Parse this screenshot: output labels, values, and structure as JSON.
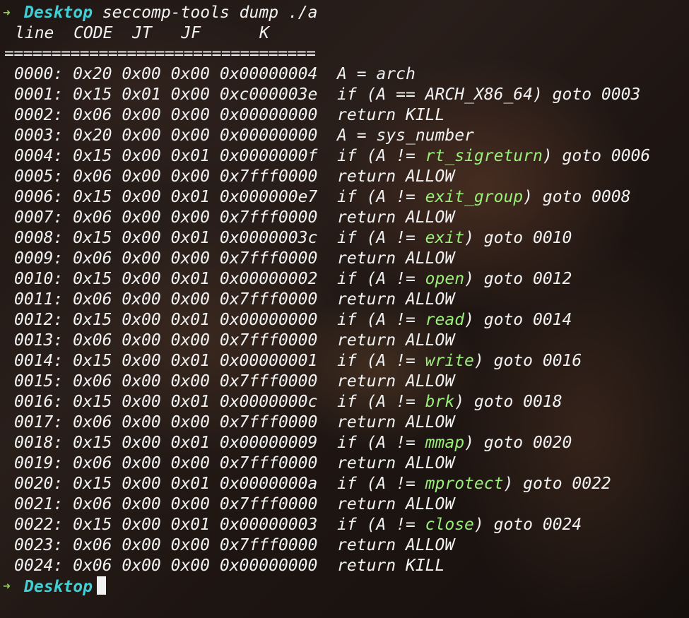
{
  "terminal": {
    "prompt_arrow": "➜",
    "directory": "Desktop",
    "command": "seccomp-tools dump ./a",
    "header": "line  CODE  JT   JF      K",
    "separator": "=================================",
    "rows": [
      {
        "addr": "0000:",
        "code": "0x20",
        "jt": "0x00",
        "jf": "0x00",
        "k": "0x00000004",
        "pre": "A = arch",
        "name": "",
        "post": ""
      },
      {
        "addr": "0001:",
        "code": "0x15",
        "jt": "0x01",
        "jf": "0x00",
        "k": "0xc000003e",
        "pre": "if (A == ARCH_X86_64) goto 0003",
        "name": "",
        "post": ""
      },
      {
        "addr": "0002:",
        "code": "0x06",
        "jt": "0x00",
        "jf": "0x00",
        "k": "0x00000000",
        "pre": "return KILL",
        "name": "",
        "post": ""
      },
      {
        "addr": "0003:",
        "code": "0x20",
        "jt": "0x00",
        "jf": "0x00",
        "k": "0x00000000",
        "pre": "A = sys_number",
        "name": "",
        "post": ""
      },
      {
        "addr": "0004:",
        "code": "0x15",
        "jt": "0x00",
        "jf": "0x01",
        "k": "0x0000000f",
        "pre": "if (A != ",
        "name": "rt_sigreturn",
        "post": ") goto 0006"
      },
      {
        "addr": "0005:",
        "code": "0x06",
        "jt": "0x00",
        "jf": "0x00",
        "k": "0x7fff0000",
        "pre": "return ALLOW",
        "name": "",
        "post": ""
      },
      {
        "addr": "0006:",
        "code": "0x15",
        "jt": "0x00",
        "jf": "0x01",
        "k": "0x000000e7",
        "pre": "if (A != ",
        "name": "exit_group",
        "post": ") goto 0008"
      },
      {
        "addr": "0007:",
        "code": "0x06",
        "jt": "0x00",
        "jf": "0x00",
        "k": "0x7fff0000",
        "pre": "return ALLOW",
        "name": "",
        "post": ""
      },
      {
        "addr": "0008:",
        "code": "0x15",
        "jt": "0x00",
        "jf": "0x01",
        "k": "0x0000003c",
        "pre": "if (A != ",
        "name": "exit",
        "post": ") goto 0010"
      },
      {
        "addr": "0009:",
        "code": "0x06",
        "jt": "0x00",
        "jf": "0x00",
        "k": "0x7fff0000",
        "pre": "return ALLOW",
        "name": "",
        "post": ""
      },
      {
        "addr": "0010:",
        "code": "0x15",
        "jt": "0x00",
        "jf": "0x01",
        "k": "0x00000002",
        "pre": "if (A != ",
        "name": "open",
        "post": ") goto 0012"
      },
      {
        "addr": "0011:",
        "code": "0x06",
        "jt": "0x00",
        "jf": "0x00",
        "k": "0x7fff0000",
        "pre": "return ALLOW",
        "name": "",
        "post": ""
      },
      {
        "addr": "0012:",
        "code": "0x15",
        "jt": "0x00",
        "jf": "0x01",
        "k": "0x00000000",
        "pre": "if (A != ",
        "name": "read",
        "post": ") goto 0014"
      },
      {
        "addr": "0013:",
        "code": "0x06",
        "jt": "0x00",
        "jf": "0x00",
        "k": "0x7fff0000",
        "pre": "return ALLOW",
        "name": "",
        "post": ""
      },
      {
        "addr": "0014:",
        "code": "0x15",
        "jt": "0x00",
        "jf": "0x01",
        "k": "0x00000001",
        "pre": "if (A != ",
        "name": "write",
        "post": ") goto 0016"
      },
      {
        "addr": "0015:",
        "code": "0x06",
        "jt": "0x00",
        "jf": "0x00",
        "k": "0x7fff0000",
        "pre": "return ALLOW",
        "name": "",
        "post": ""
      },
      {
        "addr": "0016:",
        "code": "0x15",
        "jt": "0x00",
        "jf": "0x01",
        "k": "0x0000000c",
        "pre": "if (A != ",
        "name": "brk",
        "post": ") goto 0018"
      },
      {
        "addr": "0017:",
        "code": "0x06",
        "jt": "0x00",
        "jf": "0x00",
        "k": "0x7fff0000",
        "pre": "return ALLOW",
        "name": "",
        "post": ""
      },
      {
        "addr": "0018:",
        "code": "0x15",
        "jt": "0x00",
        "jf": "0x01",
        "k": "0x00000009",
        "pre": "if (A != ",
        "name": "mmap",
        "post": ") goto 0020"
      },
      {
        "addr": "0019:",
        "code": "0x06",
        "jt": "0x00",
        "jf": "0x00",
        "k": "0x7fff0000",
        "pre": "return ALLOW",
        "name": "",
        "post": ""
      },
      {
        "addr": "0020:",
        "code": "0x15",
        "jt": "0x00",
        "jf": "0x01",
        "k": "0x0000000a",
        "pre": "if (A != ",
        "name": "mprotect",
        "post": ") goto 0022"
      },
      {
        "addr": "0021:",
        "code": "0x06",
        "jt": "0x00",
        "jf": "0x00",
        "k": "0x7fff0000",
        "pre": "return ALLOW",
        "name": "",
        "post": ""
      },
      {
        "addr": "0022:",
        "code": "0x15",
        "jt": "0x00",
        "jf": "0x01",
        "k": "0x00000003",
        "pre": "if (A != ",
        "name": "close",
        "post": ") goto 0024"
      },
      {
        "addr": "0023:",
        "code": "0x06",
        "jt": "0x00",
        "jf": "0x00",
        "k": "0x7fff0000",
        "pre": "return ALLOW",
        "name": "",
        "post": ""
      },
      {
        "addr": "0024:",
        "code": "0x06",
        "jt": "0x00",
        "jf": "0x00",
        "k": "0x00000000",
        "pre": "return KILL",
        "name": "",
        "post": ""
      }
    ],
    "colors": {
      "text": "#f2f2f2",
      "directory": "#3fd0d6",
      "arrow": "#8fd14f",
      "syscall": "#9aef7a"
    }
  }
}
